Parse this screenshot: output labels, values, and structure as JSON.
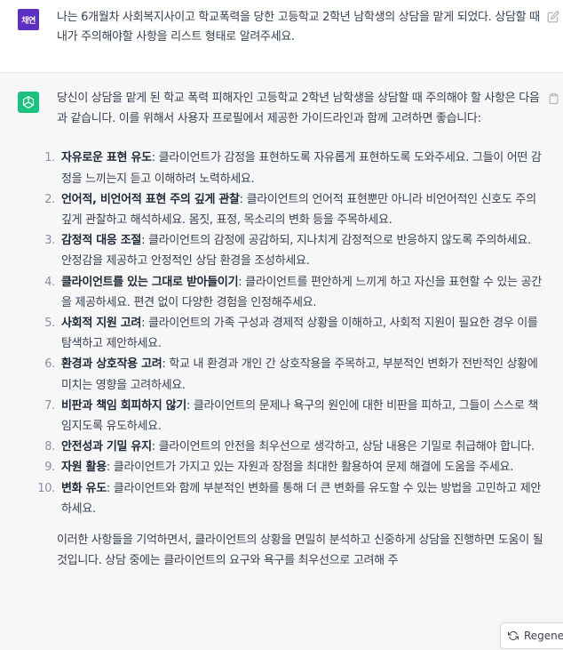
{
  "user_message": {
    "avatar_text": "채연",
    "text": "나는 6개월차 사회복지사이고 학교폭력을 당한 고등학교 2학년 남학생의 상담을 맡게 되었다. 상담할 때 내가 주의해야할 사항을 리스트 형태로 알려주세요."
  },
  "assistant_message": {
    "intro": "당신이 상담을 맡게 된 학교 폭력 피해자인 고등학교 2학년 남학생을 상담할 때 주의해야 할 사항은 다음과 같습니다. 이를 위해서 사용자 프로필에서 제공한 가이드라인과 함께 고려하면 좋습니다:",
    "items": [
      {
        "num": "1.",
        "title": "자유로운 표현 유도",
        "text": ": 클라이언트가 감정을 표현하도록 자유롭게 표현하도록 도와주세요. 그들이 어떤 감정을 느끼는지 듣고 이해하려 노력하세요."
      },
      {
        "num": "2.",
        "title": "언어적, 비언어적 표현 주의 깊게 관찰",
        "text": ": 클라이언트의 언어적 표현뿐만 아니라 비언어적인 신호도 주의 깊게 관찰하고 해석하세요. 몸짓, 표정, 목소리의 변화 등을 주목하세요."
      },
      {
        "num": "3.",
        "title": "감정적 대응 조절",
        "text": ": 클라이언트의 감정에 공감하되, 지나치게 감정적으로 반응하지 않도록 주의하세요. 안정감을 제공하고 안정적인 상담 환경을 조성하세요."
      },
      {
        "num": "4.",
        "title": "클라이언트를 있는 그대로 받아들이기",
        "text": ": 클라이언트를 편안하게 느끼게 하고 자신을 표현할 수 있는 공간을 제공하세요. 편견 없이 다양한 경험을 인정해주세요."
      },
      {
        "num": "5.",
        "title": "사회적 지원 고려",
        "text": ": 클라이언트의 가족 구성과 경제적 상황을 이해하고, 사회적 지원이 필요한 경우 이를 탐색하고 제안하세요."
      },
      {
        "num": "6.",
        "title": "환경과 상호작용 고려",
        "text": ": 학교 내 환경과 개인 간 상호작용을 주목하고, 부분적인 변화가 전반적인 상황에 미치는 영향을 고려하세요."
      },
      {
        "num": "7.",
        "title": "비판과 책임 회피하지 않기",
        "text": ": 클라이언트의 문제나 욕구의 원인에 대한 비판을 피하고, 그들이 스스로 책임지도록 유도하세요."
      },
      {
        "num": "8.",
        "title": "안전성과 기밀 유지",
        "text": ": 클라이언트의 안전을 최우선으로 생각하고, 상담 내용은 기밀로 취급해야 합니다."
      },
      {
        "num": "9.",
        "title": "자원 활용",
        "text": ": 클라이언트가 가지고 있는 자원과 장점을 최대한 활용하여 문제 해결에 도움을 주세요."
      },
      {
        "num": "10.",
        "title": "변화 유도",
        "text": ": 클라이언트와 함께 부분적인 변화를 통해 더 큰 변화를 유도할 수 있는 방법을 고민하고 제안하세요."
      }
    ],
    "outro": "이러한 사항들을 기억하면서, 클라이언트의 상황을 면밀히 분석하고 신중하게 상담을 진행하면 도움이 될 것입니다. 상담 중에는 클라이언트의 요구와 욕구를 최우선으로 고려해 주"
  },
  "controls": {
    "regenerate_label": "Regener"
  },
  "colors": {
    "user_avatar": "#5b2fc4",
    "bot_avatar": "#19c37d",
    "assistant_bg": "#f7f7f8"
  },
  "icons": [
    "edit-icon",
    "copy-icon",
    "openai-logo-icon",
    "refresh-icon"
  ]
}
